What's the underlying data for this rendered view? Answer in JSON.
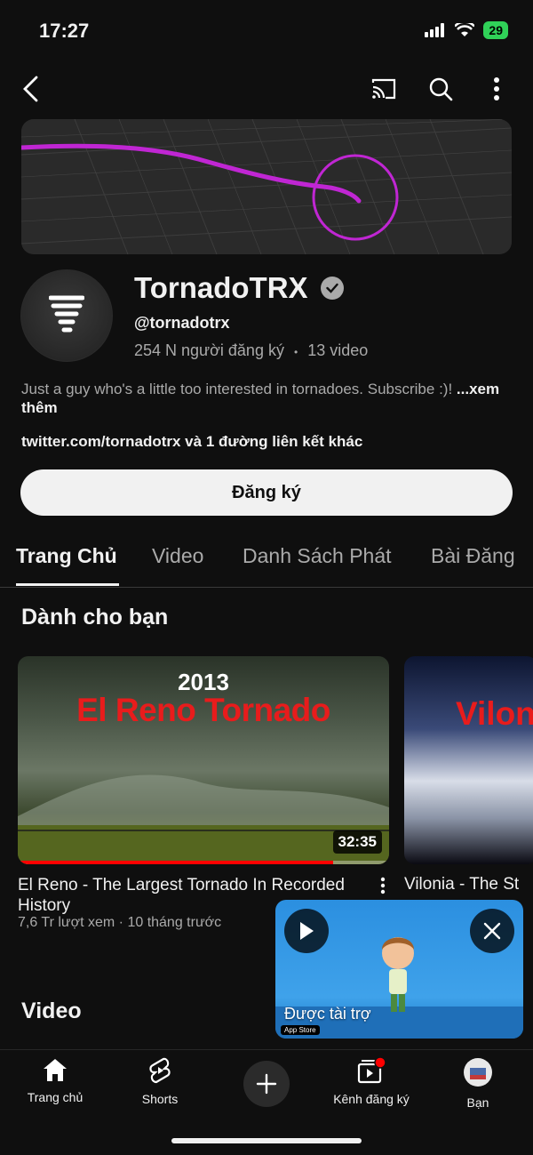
{
  "status_bar": {
    "time": "17:27",
    "battery": "29"
  },
  "icons": {
    "back": "chevron-left-icon",
    "cast": "cast-icon",
    "search": "search-icon",
    "more": "more-vertical-icon"
  },
  "channel": {
    "name": "TornadoTRX",
    "handle": "@tornadotrx",
    "subscribers": "254 N người đăng ký",
    "separator": "•",
    "video_count": "13 video",
    "description": "Just a guy who's a little too interested in tornadoes. Subscribe :)!",
    "more": "...xem thêm",
    "links": "twitter.com/tornadotrx và 1 đường liên kết khác"
  },
  "subscribe_label": "Đăng ký",
  "tabs": [
    {
      "label": "Trang Chủ"
    },
    {
      "label": "Video"
    },
    {
      "label": "Danh Sách Phát"
    },
    {
      "label": "Bài Đăng"
    }
  ],
  "for_you": {
    "title": "Dành cho bạn",
    "videos": [
      {
        "thumb_year": "2013",
        "thumb_title": "El Reno Tornado",
        "duration": "32:35",
        "watched_fraction": 0.85,
        "title": "El Reno - The Largest Tornado In Recorded History",
        "meta": "7,6 Tr lượt xem · 10 tháng trước"
      },
      {
        "thumb_title": "Vilon",
        "title": "Vilonia - The St"
      }
    ]
  },
  "videos_section": {
    "title": "Video"
  },
  "ad": {
    "label": "Được tài trợ",
    "store": "App Store"
  },
  "bottom_nav": {
    "home": "Trang chủ",
    "shorts": "Shorts",
    "subscriptions": "Kênh đăng ký",
    "you": "Bạn"
  },
  "colors": {
    "accent": "#ff0000",
    "banner_path": "#c026d3",
    "background": "#0f0f0f"
  }
}
